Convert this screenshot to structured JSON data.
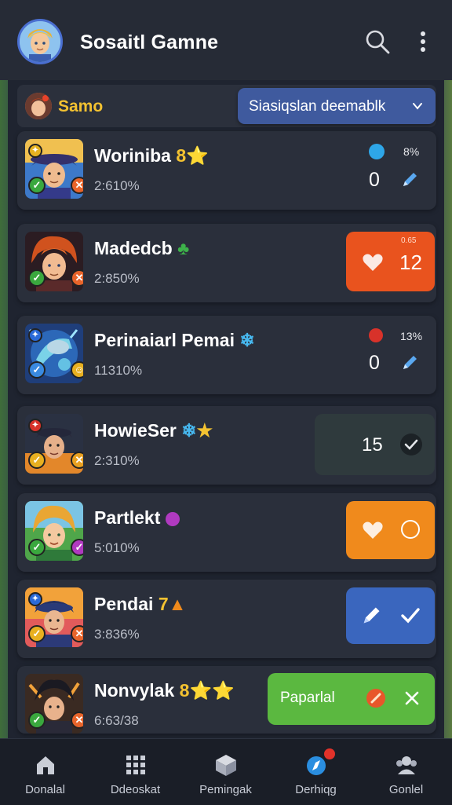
{
  "app": {
    "title": "Sosaitl Gamne"
  },
  "subbar": {
    "user_name": "Samo",
    "dropdown_label": "Siasiqslan deemablk"
  },
  "colors": {
    "background": "#1f2430",
    "card": "#2a2f3b",
    "accent_blue": "#3f5a9e",
    "orange_red": "#e9531e",
    "orange": "#f08a1c",
    "green": "#5bb840",
    "dark_box": "#2f3a3d"
  },
  "players": [
    {
      "name": "Worinibа",
      "name_suffix": "8⭐",
      "percent": "2:610%",
      "stat_top": "8%",
      "stat_bottom": "0"
    },
    {
      "name": "Madedcb",
      "percent": "2:850%",
      "action_small": "0.65",
      "action_value": "12"
    },
    {
      "name": "Perinaiarl Pemai",
      "percent": "11310%",
      "stat_top": "13%",
      "stat_bottom": "0"
    },
    {
      "name": "HowieSer",
      "percent": "2:310%",
      "action_value": "15"
    },
    {
      "name": "Partlekt",
      "percent": "5:010%"
    },
    {
      "name": "Pendai",
      "name_suffix": "7",
      "percent": "3:836%"
    },
    {
      "name": "Nonvylak",
      "name_suffix": "8⭐⭐",
      "percent": "6:63/38",
      "action_label": "Paparlal"
    }
  ],
  "bottom_nav": [
    {
      "label": "Donalal",
      "icon": "home-icon"
    },
    {
      "label": "Ddeoskat",
      "icon": "grid-icon"
    },
    {
      "label": "Pemingak",
      "icon": "cube-icon"
    },
    {
      "label": "Derhiqg",
      "icon": "compass-icon"
    },
    {
      "label": "Gonlel",
      "icon": "user-group-icon"
    }
  ]
}
